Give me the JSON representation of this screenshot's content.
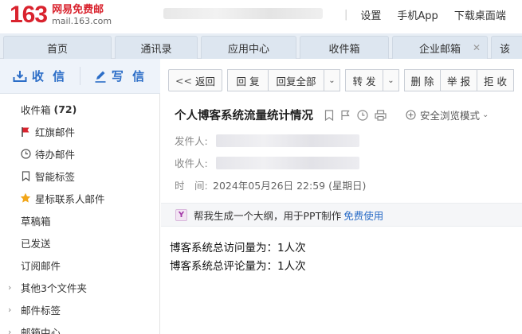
{
  "header": {
    "logo_number": "163",
    "logo_name": "网易免费邮",
    "logo_url": "mail.163.com",
    "links": [
      "设置",
      "手机App",
      "下载桌面端"
    ]
  },
  "tabs": [
    {
      "label": "首页"
    },
    {
      "label": "通讯录"
    },
    {
      "label": "应用中心"
    },
    {
      "label": "收件箱"
    },
    {
      "label": "企业邮箱"
    },
    {
      "label": "该"
    }
  ],
  "sidebar": {
    "receive_label": "收 信",
    "write_label": "写 信",
    "folders": [
      {
        "label": "收件箱",
        "count": "(72)"
      },
      {
        "label": "红旗邮件"
      },
      {
        "label": "待办邮件"
      },
      {
        "label": "智能标签"
      },
      {
        "label": "星标联系人邮件"
      },
      {
        "label": "草稿箱"
      },
      {
        "label": "已发送"
      },
      {
        "label": "订阅邮件"
      },
      {
        "label": "其他3个文件夹"
      },
      {
        "label": "邮件标签"
      },
      {
        "label": "邮箱中心"
      }
    ]
  },
  "toolbar": {
    "back": "返回",
    "reply": "回 复",
    "reply_all": "回复全部",
    "forward": "转 发",
    "delete": "删 除",
    "report": "举 报",
    "reject": "拒 收"
  },
  "mail": {
    "subject": "个人博客系统流量统计情况",
    "safe_mode": "安全浏览模式",
    "from_label": "发件人:",
    "to_label": "收件人:",
    "time_label": "时　间:",
    "time_value": "2024年05月26日 22:59 (星期日)",
    "ai_prompt": "帮我生成一个大纲，用于PPT制作",
    "ai_link": "免费使用",
    "body": [
      "博客系统总访问量为：1人次",
      "博客系统总评论量为：1人次"
    ]
  },
  "colors": {
    "brand_red": "#d9232e",
    "link_blue": "#2b6dc7",
    "flag_red": "#d9232e",
    "star_orange": "#f2a619"
  }
}
